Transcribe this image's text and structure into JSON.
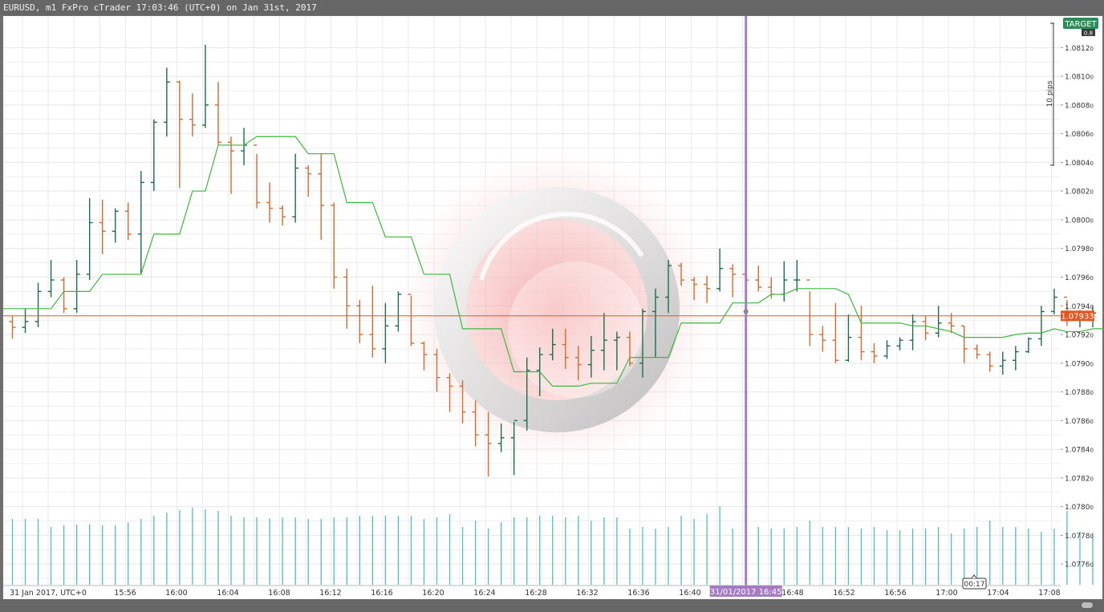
{
  "window": {
    "title": "EURUSD, m1 FxPro cTrader 17:03:46 (UTC+0) on Jan 31st, 2017"
  },
  "colors": {
    "bull": "#1f6b4e",
    "bear": "#d36b2e",
    "ma_line": "#3cb83c",
    "volume": "#4fbfbf",
    "price_line": "#e25822",
    "crosshair": "#a57cc2",
    "target": "#2e8b57",
    "background": "#ffffff",
    "grid": "#e6e6e6"
  },
  "labels": {
    "target": "TARGET",
    "target_sub": "0.8",
    "pips": "10 pips",
    "current_price": "1.07933",
    "crosshair_time": "31/01/2017 16:45",
    "countdown": "00:17"
  },
  "chart_data": {
    "type": "ohlc",
    "symbol": "EURUSD",
    "timeframe": "m1",
    "x_axis": {
      "ticks": [
        "31 Jan 2017, UTC+0",
        "15:56",
        "16:00",
        "16:04",
        "16:08",
        "16:12",
        "16:16",
        "16:20",
        "16:24",
        "16:28",
        "16:32",
        "16:36",
        "16:40",
        "16:48",
        "16:52",
        "16:56",
        "17:00",
        "17:04",
        "17:08"
      ]
    },
    "y_axis": {
      "ylim": [
        1.07745,
        1.08142
      ],
      "ticks": [
        "1.0812",
        "1.0810",
        "1.0808",
        "1.0806",
        "1.0804",
        "1.0802",
        "1.0800",
        "1.0798",
        "1.0796",
        "1.0794",
        "1.0792",
        "1.0790",
        "1.0788",
        "1.0786",
        "1.0784",
        "1.0782",
        "1.0780",
        "1.0778",
        "1.0776"
      ],
      "tick_suffix": "0"
    },
    "current_price": 1.07933,
    "candles": [
      {
        "o": 1.07929,
        "h": 1.07933,
        "l": 1.07917,
        "c": 1.07925
      },
      {
        "o": 1.07925,
        "h": 1.07938,
        "l": 1.07921,
        "c": 1.07929
      },
      {
        "o": 1.07929,
        "h": 1.07956,
        "l": 1.07925,
        "c": 1.0795
      },
      {
        "o": 1.0795,
        "h": 1.07972,
        "l": 1.07946,
        "c": 1.07958
      },
      {
        "o": 1.07958,
        "h": 1.0796,
        "l": 1.07935,
        "c": 1.07938
      },
      {
        "o": 1.07938,
        "h": 1.07972,
        "l": 1.07935,
        "c": 1.07962
      },
      {
        "o": 1.07962,
        "h": 1.08015,
        "l": 1.07958,
        "c": 1.07998
      },
      {
        "o": 1.07998,
        "h": 1.08014,
        "l": 1.07976,
        "c": 1.07992
      },
      {
        "o": 1.07992,
        "h": 1.08008,
        "l": 1.07984,
        "c": 1.08006
      },
      {
        "o": 1.08006,
        "h": 1.08012,
        "l": 1.07986,
        "c": 1.0799
      },
      {
        "o": 1.0799,
        "h": 1.08034,
        "l": 1.07962,
        "c": 1.08026
      },
      {
        "o": 1.08026,
        "h": 1.0807,
        "l": 1.0802,
        "c": 1.08068
      },
      {
        "o": 1.08068,
        "h": 1.08106,
        "l": 1.08058,
        "c": 1.08096
      },
      {
        "o": 1.08096,
        "h": 1.08097,
        "l": 1.08022,
        "c": 1.0807
      },
      {
        "o": 1.0807,
        "h": 1.08088,
        "l": 1.08058,
        "c": 1.08066
      },
      {
        "o": 1.08066,
        "h": 1.08122,
        "l": 1.08064,
        "c": 1.0808
      },
      {
        "o": 1.0808,
        "h": 1.08096,
        "l": 1.08052,
        "c": 1.08054
      },
      {
        "o": 1.08054,
        "h": 1.08058,
        "l": 1.08018,
        "c": 1.08048
      },
      {
        "o": 1.08048,
        "h": 1.08064,
        "l": 1.08038,
        "c": 1.08052
      },
      {
        "o": 1.08052,
        "h": 1.08046,
        "l": 1.08008,
        "c": 1.08012
      },
      {
        "o": 1.08012,
        "h": 1.08026,
        "l": 1.07998,
        "c": 1.08008
      },
      {
        "o": 1.08008,
        "h": 1.0801,
        "l": 1.07996,
        "c": 1.08002
      },
      {
        "o": 1.08002,
        "h": 1.08046,
        "l": 1.07998,
        "c": 1.08036
      },
      {
        "o": 1.08036,
        "h": 1.08038,
        "l": 1.08016,
        "c": 1.08032
      },
      {
        "o": 1.08032,
        "h": 1.08046,
        "l": 1.07986,
        "c": 1.0801
      },
      {
        "o": 1.0801,
        "h": 1.08012,
        "l": 1.07952,
        "c": 1.0796
      },
      {
        "o": 1.0796,
        "h": 1.07966,
        "l": 1.07924,
        "c": 1.0794
      },
      {
        "o": 1.0794,
        "h": 1.07944,
        "l": 1.07914,
        "c": 1.0792
      },
      {
        "o": 1.0792,
        "h": 1.07954,
        "l": 1.07904,
        "c": 1.0791
      },
      {
        "o": 1.0791,
        "h": 1.07942,
        "l": 1.079,
        "c": 1.07926
      },
      {
        "o": 1.07926,
        "h": 1.0795,
        "l": 1.07922,
        "c": 1.07948
      },
      {
        "o": 1.07948,
        "h": 1.07947,
        "l": 1.07912,
        "c": 1.07914
      },
      {
        "o": 1.07914,
        "h": 1.07915,
        "l": 1.07895,
        "c": 1.07906
      },
      {
        "o": 1.07906,
        "h": 1.0791,
        "l": 1.0788,
        "c": 1.0789
      },
      {
        "o": 1.0789,
        "h": 1.07893,
        "l": 1.07866,
        "c": 1.07884
      },
      {
        "o": 1.07884,
        "h": 1.07888,
        "l": 1.07858,
        "c": 1.07866
      },
      {
        "o": 1.07866,
        "h": 1.07874,
        "l": 1.07842,
        "c": 1.0785
      },
      {
        "o": 1.0785,
        "h": 1.07866,
        "l": 1.07821,
        "c": 1.07844
      },
      {
        "o": 1.07844,
        "h": 1.07858,
        "l": 1.07838,
        "c": 1.07848
      },
      {
        "o": 1.07848,
        "h": 1.07859,
        "l": 1.07822,
        "c": 1.0786
      },
      {
        "o": 1.0786,
        "h": 1.07904,
        "l": 1.07853,
        "c": 1.07895
      },
      {
        "o": 1.07895,
        "h": 1.07911,
        "l": 1.07877,
        "c": 1.07906
      },
      {
        "o": 1.07906,
        "h": 1.07924,
        "l": 1.07902,
        "c": 1.07913
      },
      {
        "o": 1.07913,
        "h": 1.07924,
        "l": 1.07896,
        "c": 1.07904
      },
      {
        "o": 1.07904,
        "h": 1.07912,
        "l": 1.07888,
        "c": 1.07899
      },
      {
        "o": 1.07899,
        "h": 1.07919,
        "l": 1.0789,
        "c": 1.07909
      },
      {
        "o": 1.07909,
        "h": 1.07935,
        "l": 1.07895,
        "c": 1.07916
      },
      {
        "o": 1.07916,
        "h": 1.07922,
        "l": 1.07895,
        "c": 1.07918
      },
      {
        "o": 1.07918,
        "h": 1.07922,
        "l": 1.07898,
        "c": 1.079
      },
      {
        "o": 1.079,
        "h": 1.07938,
        "l": 1.0789,
        "c": 1.07936
      },
      {
        "o": 1.07936,
        "h": 1.07952,
        "l": 1.07904,
        "c": 1.07946
      },
      {
        "o": 1.07946,
        "h": 1.07972,
        "l": 1.07935,
        "c": 1.07968
      },
      {
        "o": 1.07968,
        "h": 1.0797,
        "l": 1.07954,
        "c": 1.07958
      },
      {
        "o": 1.07958,
        "h": 1.0796,
        "l": 1.07944,
        "c": 1.07955
      },
      {
        "o": 1.07955,
        "h": 1.07961,
        "l": 1.07942,
        "c": 1.07952
      },
      {
        "o": 1.07952,
        "h": 1.0798,
        "l": 1.0795,
        "c": 1.07966
      },
      {
        "o": 1.07966,
        "h": 1.07969,
        "l": 1.07946,
        "c": 1.07962
      },
      {
        "o": 1.07962,
        "h": 1.07971,
        "l": 1.0795,
        "c": 1.07958
      },
      {
        "o": 1.07958,
        "h": 1.07968,
        "l": 1.0795,
        "c": 1.07953
      },
      {
        "o": 1.07953,
        "h": 1.0796,
        "l": 1.07945,
        "c": 1.07948
      },
      {
        "o": 1.07948,
        "h": 1.07971,
        "l": 1.07943,
        "c": 1.07958
      },
      {
        "o": 1.07958,
        "h": 1.07972,
        "l": 1.0795,
        "c": 1.07958
      },
      {
        "o": 1.07958,
        "h": 1.0795,
        "l": 1.07912,
        "c": 1.0792
      },
      {
        "o": 1.0792,
        "h": 1.07926,
        "l": 1.07908,
        "c": 1.07916
      },
      {
        "o": 1.07916,
        "h": 1.07942,
        "l": 1.079,
        "c": 1.07902
      },
      {
        "o": 1.07902,
        "h": 1.07934,
        "l": 1.07901,
        "c": 1.07918
      },
      {
        "o": 1.07918,
        "h": 1.0794,
        "l": 1.07902,
        "c": 1.07908
      },
      {
        "o": 1.07908,
        "h": 1.07914,
        "l": 1.079,
        "c": 1.07905
      },
      {
        "o": 1.07905,
        "h": 1.07916,
        "l": 1.07903,
        "c": 1.07912
      },
      {
        "o": 1.07912,
        "h": 1.07918,
        "l": 1.07909,
        "c": 1.07916
      },
      {
        "o": 1.07916,
        "h": 1.07934,
        "l": 1.07909,
        "c": 1.07929
      },
      {
        "o": 1.07929,
        "h": 1.07933,
        "l": 1.07916,
        "c": 1.07921
      },
      {
        "o": 1.07921,
        "h": 1.0794,
        "l": 1.07918,
        "c": 1.07928
      },
      {
        "o": 1.07928,
        "h": 1.07935,
        "l": 1.07921,
        "c": 1.07926
      },
      {
        "o": 1.07926,
        "h": 1.07926,
        "l": 1.079,
        "c": 1.0791
      },
      {
        "o": 1.0791,
        "h": 1.07913,
        "l": 1.07903,
        "c": 1.07906
      },
      {
        "o": 1.07906,
        "h": 1.07908,
        "l": 1.07894,
        "c": 1.07898
      },
      {
        "o": 1.07898,
        "h": 1.07908,
        "l": 1.07892,
        "c": 1.07902
      },
      {
        "o": 1.07902,
        "h": 1.07912,
        "l": 1.07895,
        "c": 1.07908
      },
      {
        "o": 1.07908,
        "h": 1.07918,
        "l": 1.07907,
        "c": 1.07917
      },
      {
        "o": 1.07917,
        "h": 1.0794,
        "l": 1.07912,
        "c": 1.07936
      },
      {
        "o": 1.07936,
        "h": 1.07952,
        "l": 1.07934,
        "c": 1.07946
      },
      {
        "o": 1.07946,
        "h": 1.07944,
        "l": 1.07926,
        "c": 1.07932
      },
      {
        "o": 1.07932,
        "h": 1.07937,
        "l": 1.07925,
        "c": 1.07934
      },
      {
        "o": 1.07934,
        "h": 1.0794,
        "l": 1.07925,
        "c": 1.07935
      },
      {
        "o": 1.07935,
        "h": 1.07938,
        "l": 1.07921,
        "c": 1.07934
      },
      {
        "o": 1.07934,
        "h": 1.07939,
        "l": 1.07925,
        "c": 1.07929
      },
      {
        "o": 1.07929,
        "h": 1.07935,
        "l": 1.07928,
        "c": 1.07933
      }
    ],
    "ma_line": [
      1.07938,
      1.07938,
      1.07938,
      1.07938,
      1.0795,
      1.0795,
      1.0795,
      1.07962,
      1.07962,
      1.07962,
      1.07962,
      1.0799,
      1.0799,
      1.0799,
      1.0802,
      1.0802,
      1.08052,
      1.08052,
      1.08052,
      1.08058,
      1.08058,
      1.08058,
      1.08058,
      1.08046,
      1.08046,
      1.08046,
      1.08012,
      1.08012,
      1.08012,
      1.07988,
      1.07988,
      1.07988,
      1.07962,
      1.07962,
      1.07962,
      1.07924,
      1.07924,
      1.07924,
      1.07924,
      1.07894,
      1.07894,
      1.07894,
      1.07884,
      1.07884,
      1.07884,
      1.07886,
      1.07886,
      1.07886,
      1.07904,
      1.07904,
      1.07904,
      1.07904,
      1.07928,
      1.07928,
      1.07928,
      1.07928,
      1.07942,
      1.07942,
      1.07942,
      1.07948,
      1.07948,
      1.07952,
      1.07952,
      1.07952,
      1.07952,
      1.07948,
      1.07928,
      1.07928,
      1.07928,
      1.07928,
      1.07926,
      1.07926,
      1.07924,
      1.07922,
      1.07918,
      1.07918,
      1.07918,
      1.07918,
      1.0792,
      1.07921,
      1.07921,
      1.07924,
      1.07922,
      1.07922,
      1.07924,
      1.07924,
      1.07924,
      1.07924,
      1.07928
    ],
    "volumes": [
      82,
      82,
      82,
      72,
      74,
      75,
      75,
      74,
      74,
      78,
      82,
      86,
      90,
      93,
      96,
      94,
      92,
      86,
      84,
      84,
      83,
      84,
      84,
      82,
      82,
      84,
      84,
      86,
      86,
      86,
      86,
      86,
      82,
      84,
      88,
      72,
      80,
      70,
      78,
      84,
      84,
      86,
      86,
      84,
      86,
      80,
      84,
      84,
      70,
      72,
      70,
      72,
      86,
      82,
      88,
      98,
      70,
      72,
      72,
      70,
      70,
      72,
      80,
      72,
      72,
      72,
      70,
      72,
      68,
      68,
      70,
      70,
      72,
      64,
      70,
      72,
      80,
      72,
      72,
      70,
      66,
      70,
      92,
      66,
      65,
      65,
      70,
      72,
      66
    ],
    "volume_ylim": [
      0,
      180
    ],
    "crosshair_index": 57
  }
}
